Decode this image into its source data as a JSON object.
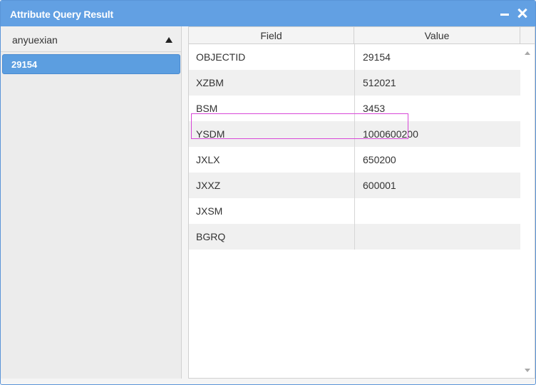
{
  "window": {
    "title": "Attribute Query Result",
    "minimize_icon": "minimize-icon",
    "close_icon": "close-icon"
  },
  "left_panel": {
    "layer_name": "anyuexian",
    "layer_caret_icon": "caret-up-icon",
    "features": [
      "29154"
    ]
  },
  "grid": {
    "columns": [
      "Field",
      "Value"
    ],
    "rows": [
      {
        "field": "OBJECTID",
        "value": "29154"
      },
      {
        "field": "XZBM",
        "value": "512021"
      },
      {
        "field": "BSM",
        "value": "3453"
      },
      {
        "field": "YSDM",
        "value": "1000600200"
      },
      {
        "field": "JXLX",
        "value": "650200"
      },
      {
        "field": "JXXZ",
        "value": "600001"
      },
      {
        "field": "JXSM",
        "value": ""
      },
      {
        "field": "BGRQ",
        "value": ""
      }
    ],
    "highlight_color": "#d848d8"
  },
  "colors": {
    "title_bar": "#62a0e3",
    "selected_item": "#5c9ee0"
  }
}
